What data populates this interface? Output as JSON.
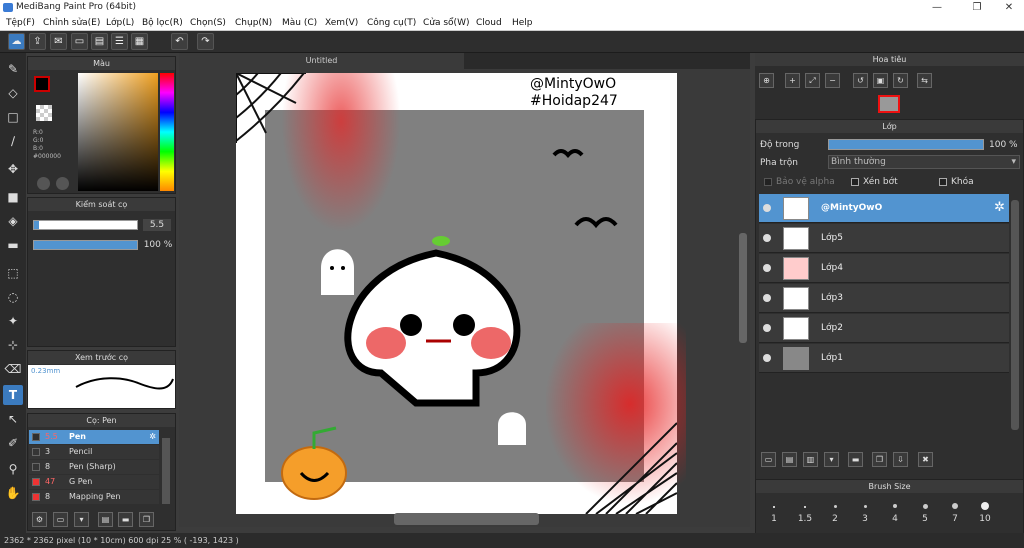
{
  "window": {
    "title": "MediBang Paint Pro (64bit)",
    "minimize": "—",
    "restore": "❐",
    "close": "✕"
  },
  "menu": [
    "Tệp(F)",
    "Chỉnh sửa(E)",
    "Lớp(L)",
    "Bộ lọc(R)",
    "Chọn(S)",
    "Chụp(N)",
    "Màu (C)",
    "Xem(V)",
    "Công cụ(T)",
    "Cửa sổ(W)",
    "Cloud",
    "Help"
  ],
  "panels": {
    "color": {
      "title": "Màu",
      "r": "R:0",
      "g": "G:0",
      "b": "B:0",
      "hex": "#000000"
    },
    "brush_control": {
      "title": "Kiểm soát cọ",
      "size": "5.5",
      "opacity": "100 %"
    },
    "brush_preview": {
      "title": "Xem trước cọ",
      "size": "0.23mm"
    },
    "brush": {
      "title": "Cọ: Pen",
      "items": [
        {
          "size": "5.5",
          "name": "Pen"
        },
        {
          "size": "3",
          "name": "Pencil"
        },
        {
          "size": "8",
          "name": "Pen (Sharp)"
        },
        {
          "size": "47",
          "name": "G Pen"
        },
        {
          "size": "8",
          "name": "Mapping Pen"
        }
      ]
    },
    "navigator": {
      "title": "Hoa tiêu"
    },
    "layer": {
      "title": "Lớp",
      "opacity_label": "Độ trong",
      "opacity_value": "100 %",
      "blend_label": "Pha trộn",
      "blend_value": "Bình thường",
      "protect_alpha": "Bảo vệ alpha",
      "clipping": "Xén bớt",
      "lock": "Khóa",
      "layers": [
        "@MintyOwO",
        "Lớp5",
        "Lớp4",
        "Lớp3",
        "Lớp2",
        "Lớp1"
      ]
    },
    "brush_size": {
      "title": "Brush Size",
      "sizes": [
        "1",
        "1.5",
        "2",
        "3",
        "4",
        "5",
        "7",
        "10"
      ]
    }
  },
  "document": {
    "tab": "Untitled",
    "watermark_line1": "@MintyOwO",
    "watermark_line2": "#Hoidap247"
  },
  "status": {
    "text": "2362 * 2362 pixel  (10 * 10cm)  600 dpi  25 %  ( -193, 1423 )"
  },
  "colors": {
    "accent": "#5294d0",
    "fg_color": "#000000"
  }
}
